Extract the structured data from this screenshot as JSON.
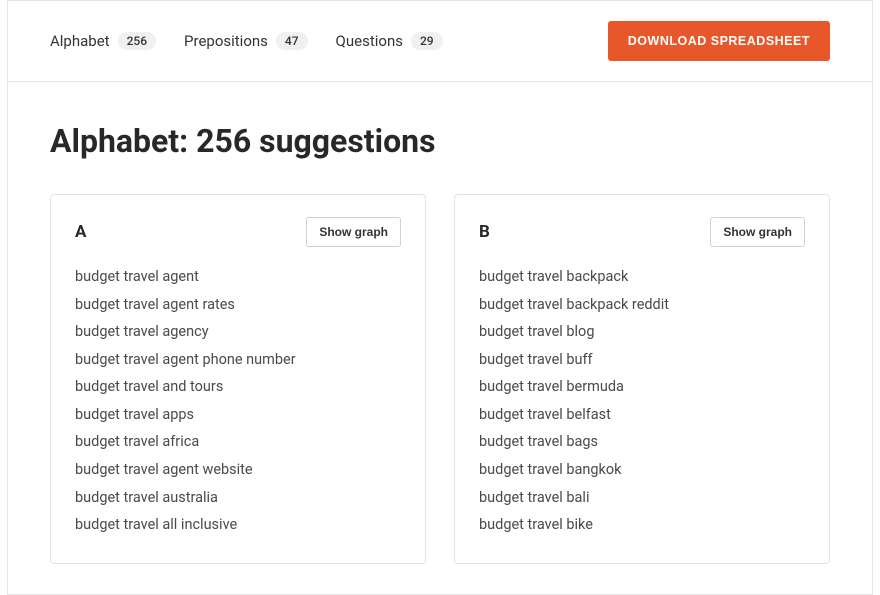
{
  "tabs": [
    {
      "label": "Alphabet",
      "count": "256"
    },
    {
      "label": "Prepositions",
      "count": "47"
    },
    {
      "label": "Questions",
      "count": "29"
    }
  ],
  "download_label": "DOWNLOAD SPREADSHEET",
  "heading": "Alphabet: 256 suggestions",
  "show_graph_label": "Show graph",
  "cards": [
    {
      "letter": "A",
      "items": [
        "budget travel agent",
        "budget travel agent rates",
        "budget travel agency",
        "budget travel agent phone number",
        "budget travel and tours",
        "budget travel apps",
        "budget travel africa",
        "budget travel agent website",
        "budget travel australia",
        "budget travel all inclusive"
      ]
    },
    {
      "letter": "B",
      "items": [
        "budget travel backpack",
        "budget travel backpack reddit",
        "budget travel blog",
        "budget travel buff",
        "budget travel bermuda",
        "budget travel belfast",
        "budget travel bags",
        "budget travel bangkok",
        "budget travel bali",
        "budget travel bike"
      ]
    }
  ]
}
